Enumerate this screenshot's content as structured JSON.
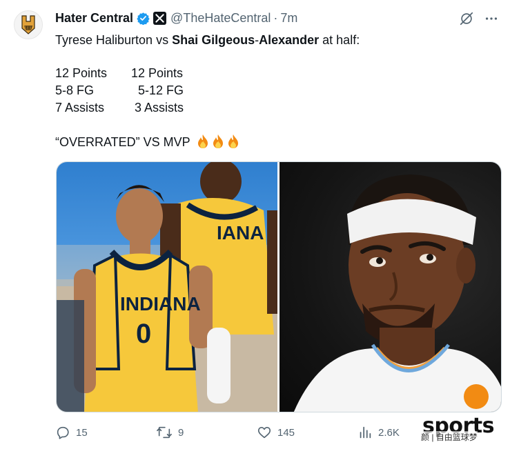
{
  "tweet": {
    "display_name": "Hater Central",
    "handle": "@TheHateCentral",
    "separator": "·",
    "time": "7m",
    "text_line1_a": "Tyrese Haliburton vs ",
    "text_line1_bold": "Shai Gilgeous",
    "text_line1_dash": "-",
    "text_line1_bold2": "Alexander",
    "text_line1_b": " at half:",
    "stats": [
      {
        "left": "12 Points",
        "right": "12 Points"
      },
      {
        "left": "5-8 FG",
        "right": "  5-12 FG"
      },
      {
        "left": "7 Assists",
        "right": " 3 Assists"
      }
    ],
    "closing_line": "“OVERRATED” VS MVP",
    "media_left": {
      "jersey_text": "INDIANA",
      "jersey_number": "0",
      "back_jersey_text": "IANA"
    },
    "actions": {
      "replies": "15",
      "reposts": "9",
      "likes": "145",
      "views": "2.6K"
    },
    "watermark": "sports",
    "watermark_sub": "颜 | 自由篮球梦"
  },
  "colors": {
    "verified_blue": "#1d9bf0",
    "muted": "#536471",
    "pacers_yellow": "#f6c83b",
    "pacers_navy": "#0c2340"
  },
  "icons": [
    "logo-icon",
    "verified-badge-icon",
    "affiliate-x-icon",
    "grok-icon",
    "more-icon",
    "reply-icon",
    "repost-icon",
    "like-icon",
    "views-icon",
    "fire-icon"
  ]
}
